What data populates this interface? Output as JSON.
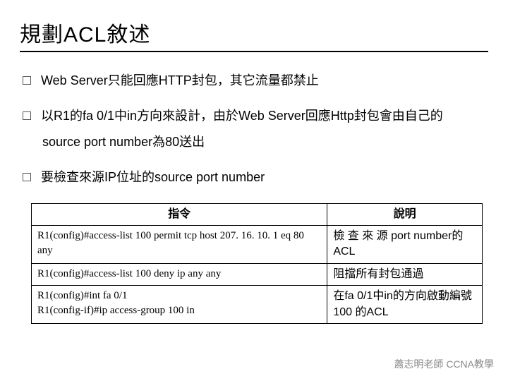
{
  "title": "規劃ACL敘述",
  "bullets": [
    "Web Server只能回應HTTP封包，其它流量都禁止",
    "以R1的fa 0/1中in方向來設計，由於Web Server回應Http封包會由自己的",
    "要檢查來源IP位址的source port number"
  ],
  "bullet2_cont": "source port number為80送出",
  "table": {
    "headers": [
      "指令",
      "說明"
    ],
    "rows": [
      {
        "cmd": "R1(config)#access-list 100 permit tcp host 207. 16. 10. 1 eq 80 any",
        "desc": "檢 查 來 源 port  number的ACL"
      },
      {
        "cmd": "R1(config)#access-list 100 deny ip any any",
        "desc": "阻擋所有封包通過"
      },
      {
        "cmd": "R1(config)#int fa 0/1\nR1(config-if)#ip access-group 100  in",
        "desc": "在fa 0/1中in的方向啟動編號100 的ACL"
      }
    ]
  },
  "footer": "蕭志明老師 CCNA教學"
}
